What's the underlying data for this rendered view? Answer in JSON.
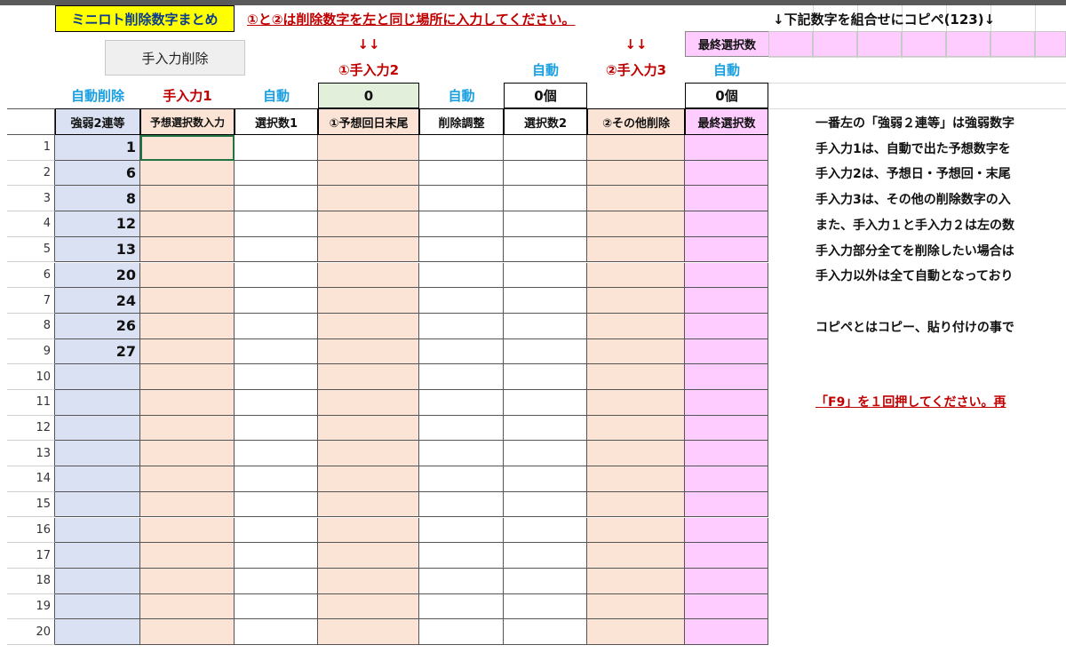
{
  "title": "ミニロト削除数字まとめ",
  "instruction": "①と②は削除数字を左と同じ場所に入力してください。",
  "copy_hint": "↓下記数字を組合せにコピペ(123)↓",
  "buttons": {
    "clear_input": "手入力削除"
  },
  "arrows": {
    "arrow1": "↓↓",
    "arrow2": "↓↓"
  },
  "final_select_label": "最終選択数",
  "group_labels": {
    "input2": "①手入力2",
    "auto_a": "自動",
    "input3": "②手入力3",
    "auto_b": "自動"
  },
  "category_row": {
    "c1": "自動削除",
    "c2": "手入力1",
    "c3": "自動",
    "c4_value": "0",
    "c5": "自動",
    "c6_value": "0個",
    "c8_value": "0個"
  },
  "columns": [
    "強弱2連等",
    "予想選択数入力",
    "選択数1",
    "①予想回日末尾",
    "削除調整",
    "選択数2",
    "②その他削除",
    "最終選択数"
  ],
  "row_numbers": [
    "1",
    "2",
    "3",
    "4",
    "5",
    "6",
    "7",
    "8",
    "9",
    "10",
    "11",
    "12",
    "13",
    "14",
    "15",
    "16",
    "17",
    "18",
    "19",
    "20"
  ],
  "strong_weak_values": [
    "1",
    "6",
    "8",
    "12",
    "13",
    "20",
    "24",
    "26",
    "27",
    "",
    "",
    "",
    "",
    "",
    "",
    "",
    "",
    "",
    "",
    ""
  ],
  "notes": [
    "一番左の「強弱２連等」は強弱数字",
    "手入力1は、自動で出た予想数字を",
    "手入力2は、予想日・予想回・末尾",
    "手入力3は、その他の削除数字の入",
    "また、手入力１と手入力２は左の数",
    "手入力部分全てを削除したい場合は",
    "手入力以外は全て自動となっており",
    "",
    "コピペとはコピー、貼り付けの事で"
  ],
  "f9_note": "「F9」を１回押してください。再",
  "colors": {
    "title_bg": "#ffff00",
    "accent_red": "#c00000",
    "accent_blue": "#1aa0e0",
    "col_blue": "#d9e1f2",
    "col_peach": "#fbe4d5",
    "col_pink": "#ffccff",
    "col_green": "#e2efda",
    "selection_green": "#217346"
  }
}
